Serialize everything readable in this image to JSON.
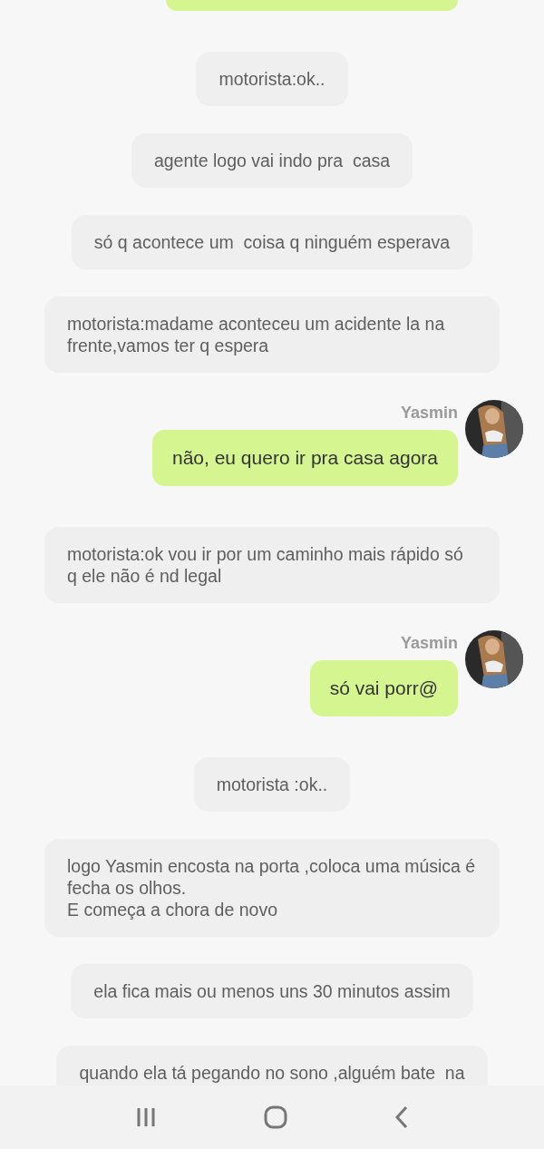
{
  "messages": [
    {
      "kind": "cut"
    },
    {
      "kind": "narration",
      "text": "motorista:ok.."
    },
    {
      "kind": "narration",
      "text": "agente logo vai indo pra  casa"
    },
    {
      "kind": "narration",
      "text": "só q acontece um  coisa q ninguém esperava"
    },
    {
      "kind": "narration",
      "text": "motorista:madame aconteceu um acidente la na frente,vamos ter q espera"
    },
    {
      "kind": "outgoing",
      "sender": "Yasmin",
      "text": "não, eu quero ir pra casa agora"
    },
    {
      "kind": "narration",
      "text": "motorista:ok vou ir por um caminho mais rápido só q ele não é nd legal"
    },
    {
      "kind": "outgoing",
      "sender": "Yasmin",
      "text": "só vai porr@"
    },
    {
      "kind": "narration",
      "text": "motorista :ok.."
    },
    {
      "kind": "narration",
      "text": "logo Yasmin encosta na porta ,coloca uma música é fecha os olhos.\nE começa a chora de novo"
    },
    {
      "kind": "narration",
      "text": "ela fica mais ou menos uns 30 minutos assim"
    },
    {
      "kind": "narration",
      "text": "quando ela tá pegando no sono ,alguém bate  na"
    }
  ]
}
